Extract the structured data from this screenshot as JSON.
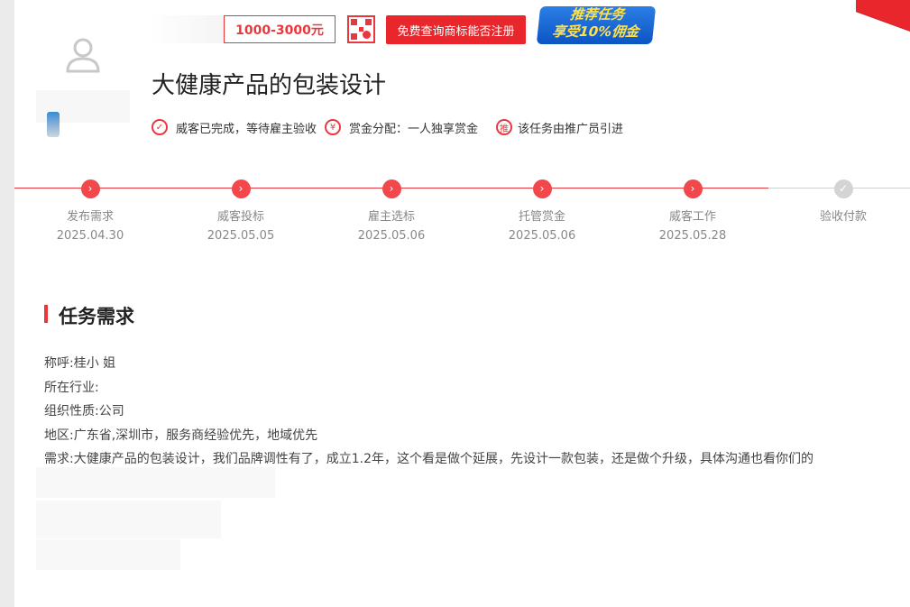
{
  "header": {
    "price_range": "1000-3000元",
    "check_button_label": "免费查询商标能否注册",
    "banner": {
      "line1": "推荐任务",
      "line2": "享受10%佣金"
    },
    "title": "大健康产品的包装设计",
    "status_completed": "威客已完成，等待雇主验收",
    "reward_allocation": "赏金分配：一人独享赏金",
    "promoter_text": "该任务由推广员引进",
    "icons": {
      "check": "check-circle-icon",
      "yen": "yen-circle-icon",
      "promote": "promote-circle-icon"
    }
  },
  "progress": {
    "steps": [
      {
        "label": "发布需求",
        "date": "2025.04.30",
        "done": true
      },
      {
        "label": "威客投标",
        "date": "2025.05.05",
        "done": true
      },
      {
        "label": "雇主选标",
        "date": "2025.05.06",
        "done": true
      },
      {
        "label": "托管赏金",
        "date": "2025.05.06",
        "done": true
      },
      {
        "label": "威客工作",
        "date": "2025.05.28",
        "done": true
      },
      {
        "label": "验收付款",
        "date": "",
        "done": false
      }
    ],
    "colors": {
      "done": "#f2474b",
      "pending": "#d4d4d4"
    }
  },
  "requirements": {
    "section_title": "任务需求",
    "lines": [
      "称呼:桂小 姐",
      "所在行业:",
      "组织性质:公司",
      "地区:广东省,深圳市，服务商经验优先，地域优先",
      "需求:大健康产品的包装设计，我们品牌调性有了，成立1.2年，这个看是做个延展，先设计一款包装，还是做个升级，具体沟通也看你们的"
    ]
  },
  "colors": {
    "accent": "#e8383d",
    "button": "#e8262b"
  }
}
